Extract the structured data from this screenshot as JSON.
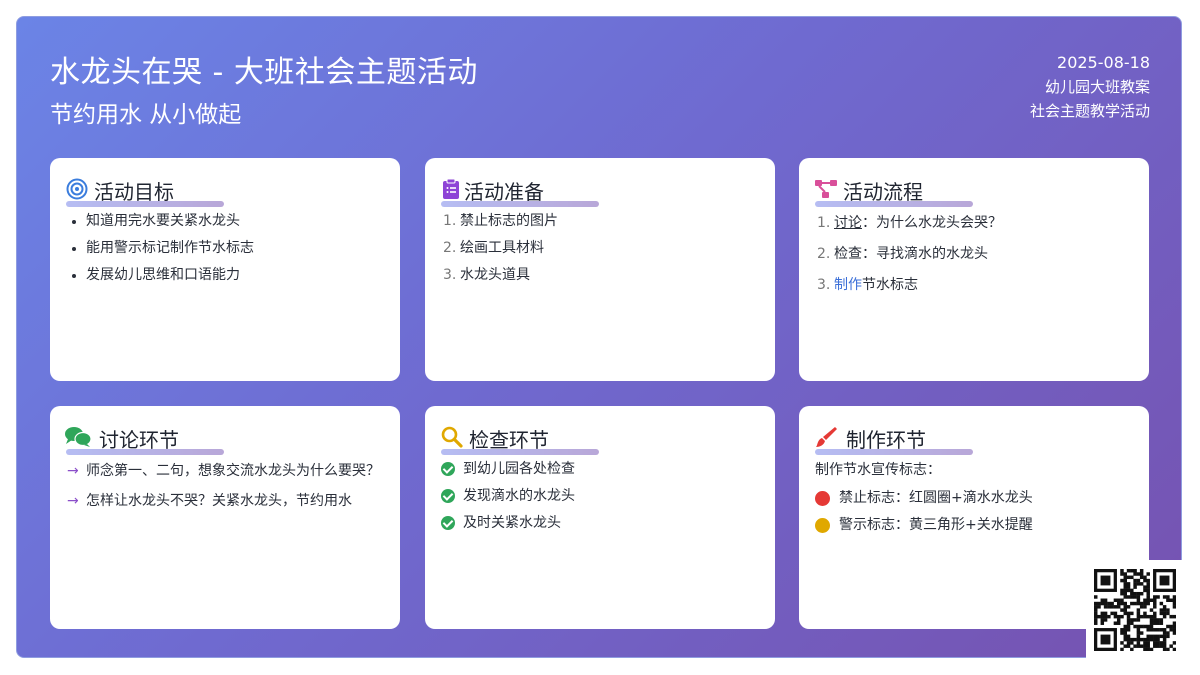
{
  "header": {
    "title": "水龙头在哭 - 大班社会主题活动",
    "subtitle": "节约用水 从小做起",
    "date": "2025-08-18",
    "meta_line1": "幼儿园大班教案",
    "meta_line2": "社会主题教学活动"
  },
  "colors": {
    "gradient_start": "#6b84e6",
    "gradient_end": "#7652b0",
    "red_dot": "#e53935",
    "yellow_dot": "#e0a800",
    "check_green": "#2fa65a"
  },
  "cards": {
    "goals": {
      "title": "活动目标",
      "icon": "target-icon",
      "items": [
        "知道用完水要关紧水龙头",
        "能用警示标记制作节水标志",
        "发展幼儿思维和口语能力"
      ]
    },
    "prep": {
      "title": "活动准备",
      "icon": "clipboard-list-icon",
      "items": [
        {
          "num": "1.",
          "text": "禁止标志的图片"
        },
        {
          "num": "2.",
          "text": "绘画工具材料"
        },
        {
          "num": "3.",
          "text": "水龙头道具"
        }
      ]
    },
    "flow": {
      "title": "活动流程",
      "icon": "flow-diagram-icon",
      "items": [
        {
          "num": "1.",
          "keyword": "讨论",
          "rest": "：为什么水龙头会哭？"
        },
        {
          "num": "2.",
          "keyword": "检查",
          "rest": "：寻找滴水的水龙头"
        },
        {
          "num": "3.",
          "keyword": "制作",
          "rest": "节水标志"
        }
      ]
    },
    "discuss": {
      "title": "讨论环节",
      "icon": "chat-bubbles-icon",
      "items": [
        "师念第一、二句，想象交流水龙头为什么要哭？",
        "怎样让水龙头不哭？关紧水龙头，节约用水"
      ]
    },
    "check": {
      "title": "检查环节",
      "icon": "magnifier-icon",
      "items": [
        "到幼儿园各处检查",
        "发现滴水的水龙头",
        "及时关紧水龙头"
      ]
    },
    "make": {
      "title": "制作环节",
      "icon": "paintbrush-icon",
      "intro": "制作节水宣传标志：",
      "items": [
        "禁止标志：红圆圈+滴水水龙头",
        "警示标志：黄三角形+关水提醒"
      ]
    }
  },
  "qr": {
    "icon": "qr-code-icon"
  }
}
